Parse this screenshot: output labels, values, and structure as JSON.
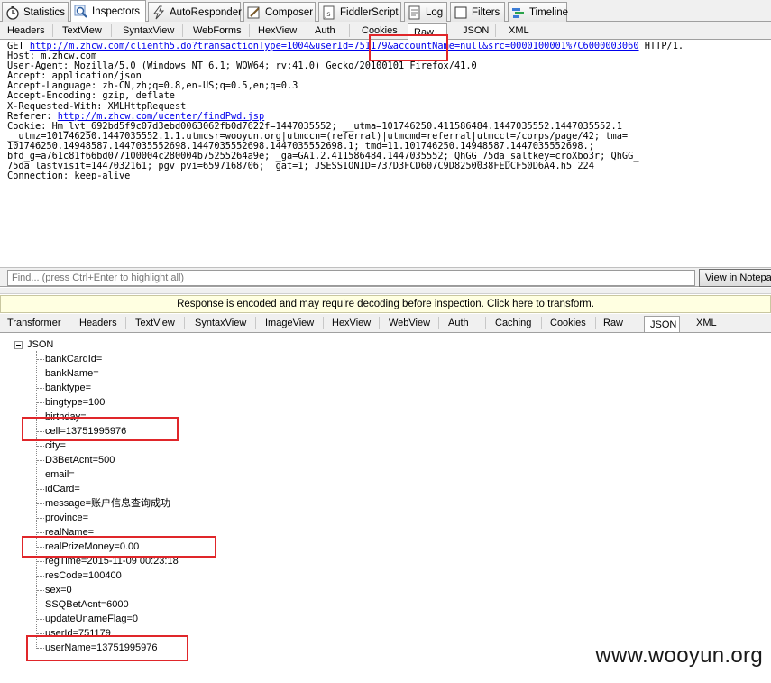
{
  "top_tabs": [
    {
      "label": "Statistics",
      "icon": "stopwatch-icon"
    },
    {
      "label": "Inspectors",
      "icon": "magnifier-icon"
    },
    {
      "label": "AutoResponder",
      "icon": "lightning-icon"
    },
    {
      "label": "Composer",
      "icon": "pencil-icon"
    },
    {
      "label": "FiddlerScript",
      "icon": "script-icon"
    },
    {
      "label": "Log",
      "icon": "log-icon"
    },
    {
      "label": "Filters",
      "icon": "checkbox-icon"
    },
    {
      "label": "Timeline",
      "icon": "timeline-icon"
    }
  ],
  "request_tabs": [
    "Headers",
    "TextView",
    "SyntaxView",
    "WebForms",
    "HexView",
    "Auth",
    "Cookies",
    "Raw",
    "JSON",
    "XML"
  ],
  "request_active_tab": "Raw",
  "raw_request": {
    "line1_method": "GET ",
    "line1_url": "http://m.zhcw.com/clienth5.do?transactionType=1004&userId=751179&accountName=null&src=0000100001%7C6000003060",
    "line1_protocol": " HTTP/1.",
    "host": "Host: m.zhcw.com",
    "user_agent": "User-Agent: Mozilla/5.0 (Windows NT 6.1; WOW64; rv:41.0) Gecko/20100101 Firefox/41.0",
    "accept": "Accept: application/json",
    "accept_language": "Accept-Language: zh-CN,zh;q=0.8,en-US;q=0.5,en;q=0.3",
    "accept_encoding": "Accept-Encoding: gzip, deflate",
    "x_requested_with": "X-Requested-With: XMLHttpRequest",
    "referer_label": "Referer: ",
    "referer_url": "http://m.zhcw.com/ucenter/findPwd.jsp",
    "cookie_line1": "Cookie: Hm_lvt_692bd5f9c07d3ebd0063062fb0d7622f=1447035552; __utma=101746250.411586484.1447035552.1447035552.1",
    "cookie_line2": "__utmz=101746250.1447035552.1.1.utmcsr=wooyun.org|utmccn=(referral)|utmcmd=referral|utmcct=/corps/page/42; tma=",
    "cookie_line3": "101746250.14948587.1447035552698.1447035552698.1447035552698.1; tmd=11.101746250.14948587.1447035552698.;",
    "cookie_line4": "bfd_g=a761c81f66bd077100004c280004b75255264a9e; _ga=GA1.2.411586484.1447035552; QhGG_75da_saltkey=croXbo3r; QhGG_",
    "cookie_line5": "75da_lastvisit=1447032161; pgv_pvi=6597168706; _gat=1; JSESSIONID=737D3FCD607C9D8250038FEDCF50D6A4.h5_224",
    "connection": "Connection: keep-alive"
  },
  "find": {
    "placeholder": "Find... (press Ctrl+Enter to highlight all)",
    "button_label": "View in Notepad"
  },
  "response_banner": "Response is encoded and may require decoding before inspection. Click here to transform.",
  "response_tabs": [
    "Transformer",
    "Headers",
    "TextView",
    "SyntaxView",
    "ImageView",
    "HexView",
    "WebView",
    "Auth",
    "Caching",
    "Cookies",
    "Raw",
    "JSON",
    "XML"
  ],
  "response_active_tab": "JSON",
  "json_tree": {
    "root": "JSON",
    "items": [
      "bankCardId=",
      "bankName=",
      "banktype=",
      "bingtype=100",
      "birthday=",
      "cell=13751995976",
      "city=",
      "D3BetAcnt=500",
      "email=",
      "idCard=",
      "message=账户信息查询成功",
      "province=",
      "realName=",
      "realPrizeMoney=0.00",
      "regTime=2015-11-09 00:23:18",
      "resCode=100400",
      "sex=0",
      "SSQBetAcnt=6000",
      "updateUnameFlag=0",
      "userId=751179",
      "userName=13751995976"
    ]
  },
  "highlight_color": "#e0262a",
  "watermark": "www.wooyun.org"
}
